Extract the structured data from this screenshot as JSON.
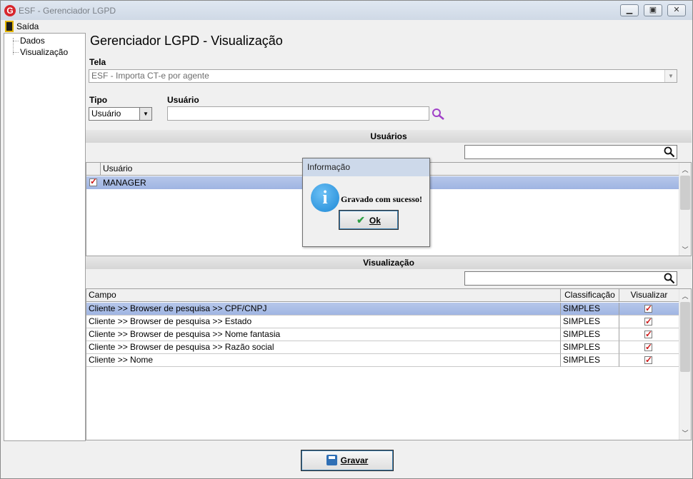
{
  "window": {
    "title": "ESF - Gerenciador LGPD",
    "app_icon_letter": "G"
  },
  "menu": {
    "exit_label": "Saída"
  },
  "tree": {
    "items": [
      "Dados",
      "Visualização"
    ]
  },
  "page_title": "Gerenciador LGPD - Visualização",
  "tela": {
    "label": "Tela",
    "value": "ESF - Importa CT-e por agente"
  },
  "tipo": {
    "label": "Tipo",
    "value": "Usuário"
  },
  "usuario": {
    "label": "Usuário",
    "value": ""
  },
  "users_section": {
    "title": "Usuários",
    "filter_value": "",
    "columns": [
      "Usuário"
    ],
    "rows": [
      {
        "checked": true,
        "name": "MANAGER"
      }
    ]
  },
  "view_section": {
    "title": "Visualização",
    "filter_value": "",
    "columns": [
      "Campo",
      "Classificação",
      "Visualizar"
    ],
    "rows": [
      {
        "campo": "Cliente >> Browser de pesquisa >> CPF/CNPJ",
        "classificacao": "SIMPLES",
        "visualizar": true
      },
      {
        "campo": "Cliente >> Browser de pesquisa >> Estado",
        "classificacao": "SIMPLES",
        "visualizar": true
      },
      {
        "campo": "Cliente >> Browser de pesquisa >> Nome fantasia",
        "classificacao": "SIMPLES",
        "visualizar": true
      },
      {
        "campo": "Cliente >> Browser de pesquisa >> Razão social",
        "classificacao": "SIMPLES",
        "visualizar": true
      },
      {
        "campo": "Cliente >> Nome",
        "classificacao": "SIMPLES",
        "visualizar": true
      }
    ]
  },
  "dialog": {
    "title": "Informação",
    "message": "Gravado com sucesso!",
    "ok_label": "Ok"
  },
  "save_button": {
    "label": "Gravar"
  },
  "colors": {
    "selection": "#a9bde6",
    "check_red": "#cc1a1a",
    "search_icon": "#a040c8"
  }
}
